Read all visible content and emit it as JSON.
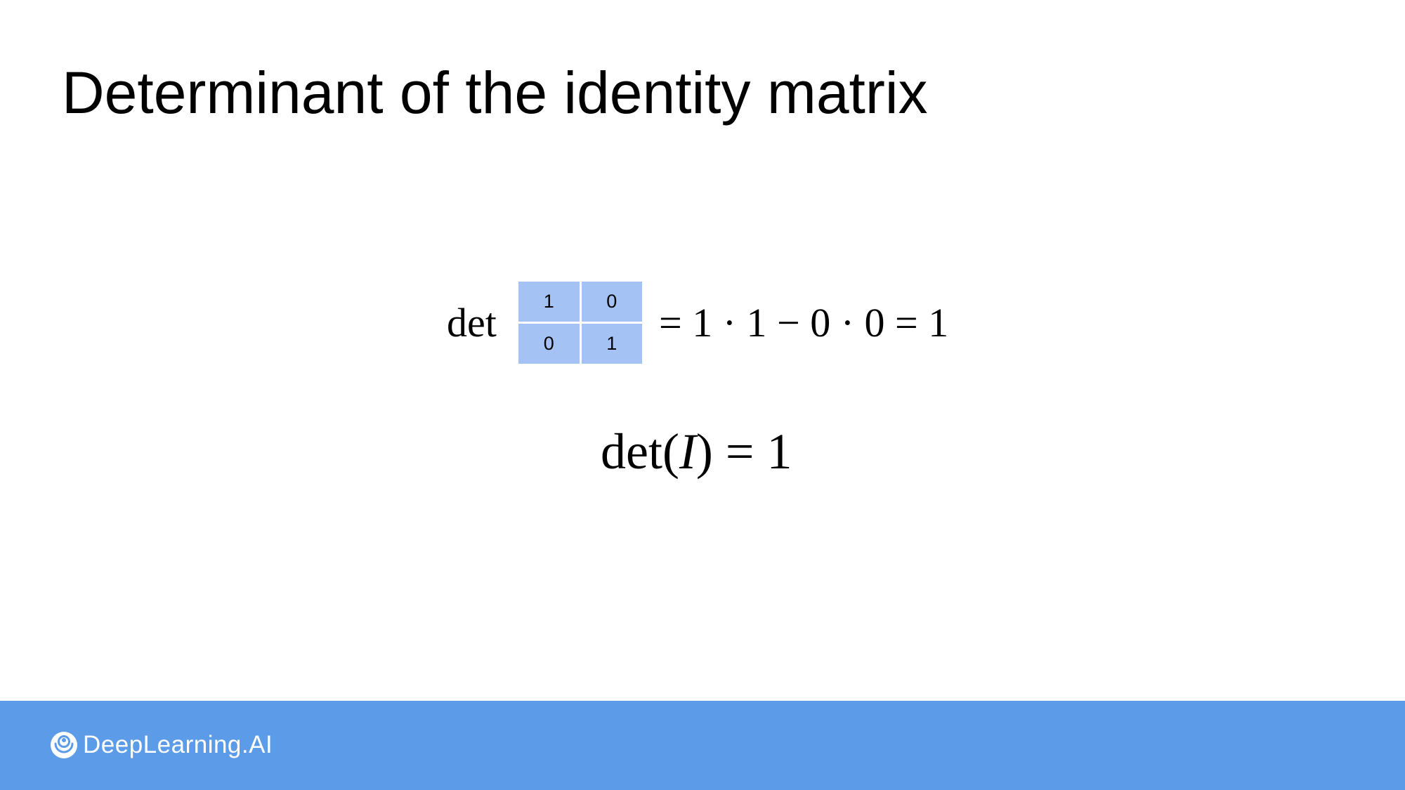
{
  "colors": {
    "background": "#ffffff",
    "matrix_cell": "#a4c2f4",
    "footer": "#5c9be8",
    "footer_text": "#ffffff"
  },
  "title": "Determinant of the identity matrix",
  "formula": {
    "det_label": "det",
    "matrix": [
      [
        "1",
        "0"
      ],
      [
        "0",
        "1"
      ]
    ],
    "expansion": "= 1 · 1 − 0 · 0 = 1"
  },
  "identity": {
    "det_prefix": "det(",
    "symbol": "I",
    "suffix": ") = 1"
  },
  "footer": {
    "brand_icon": "deeplearning-ai-logo-icon",
    "brand_name": "DeepLearning.AI"
  }
}
